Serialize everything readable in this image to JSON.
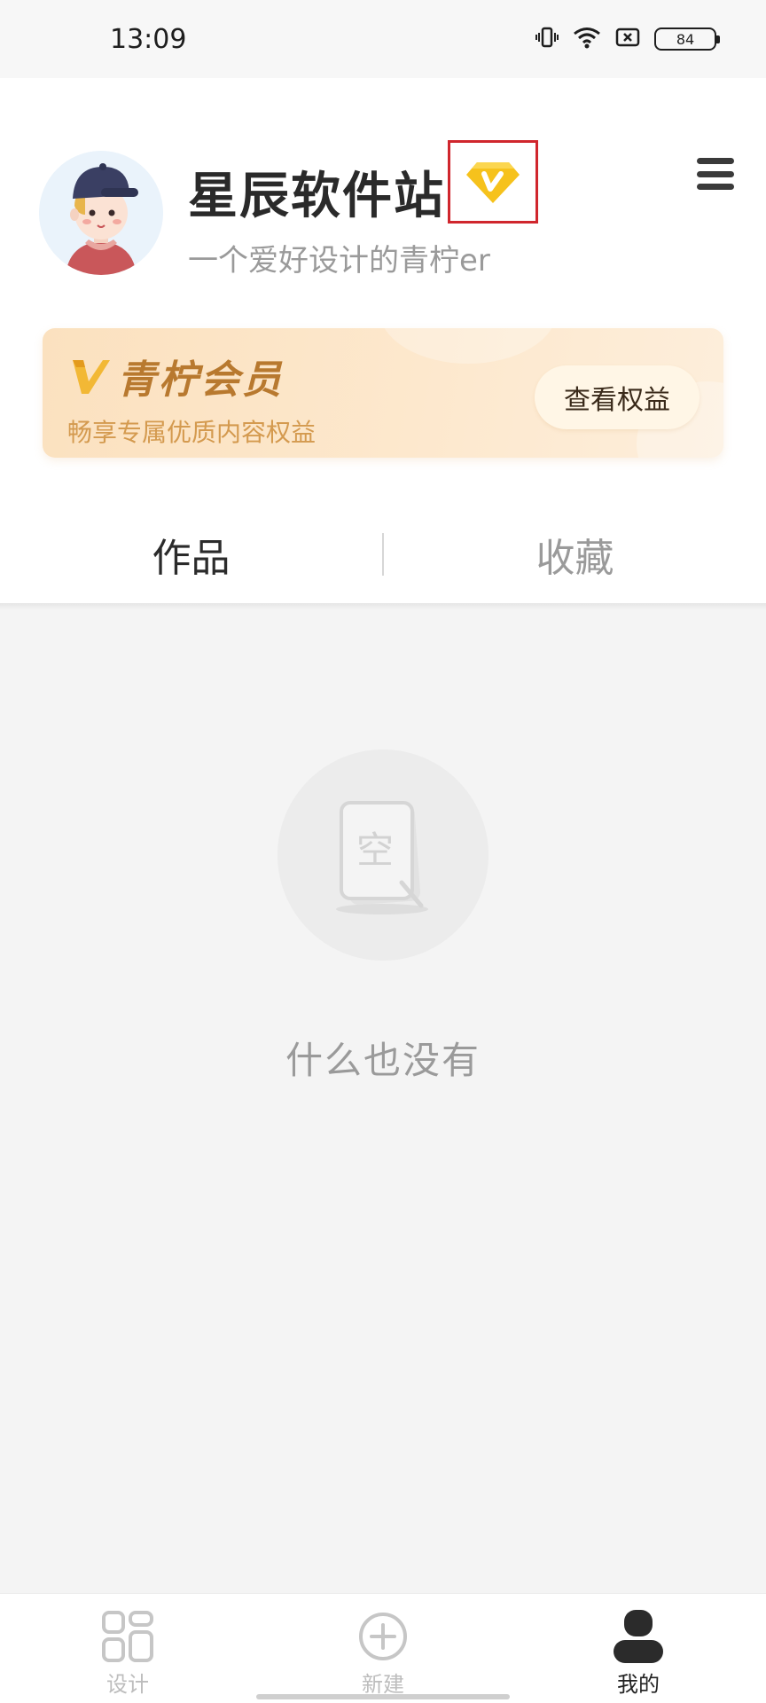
{
  "status_bar": {
    "time": "13:09",
    "battery": "84",
    "icons": [
      "vibrate-icon",
      "wifi-icon",
      "sim-icon",
      "battery-icon"
    ]
  },
  "profile": {
    "username": "星辰软件站",
    "badge_icon": "vip-v-badge-icon",
    "subtitle": "一个爱好设计的青柠er",
    "menu_icon": "hamburger-menu-icon",
    "avatar_icon": "avatar-boy-icon"
  },
  "membership": {
    "title": "青柠会员",
    "description": "畅享专属优质内容权益",
    "button_label": "查看权益",
    "accent_color": "#b8792f"
  },
  "tabs": [
    {
      "label": "作品",
      "active": true
    },
    {
      "label": "收藏",
      "active": false
    }
  ],
  "empty_state": {
    "icon": "empty-document-icon",
    "icon_text": "空",
    "message": "什么也没有"
  },
  "bottom_nav": [
    {
      "label": "设计",
      "icon": "grid-design-icon",
      "active": false
    },
    {
      "label": "新建",
      "icon": "plus-circle-icon",
      "active": false
    },
    {
      "label": "我的",
      "icon": "profile-person-icon",
      "active": true
    }
  ],
  "colors": {
    "badge_yellow": "#f6c21c",
    "highlight_box": "#d0262d"
  }
}
